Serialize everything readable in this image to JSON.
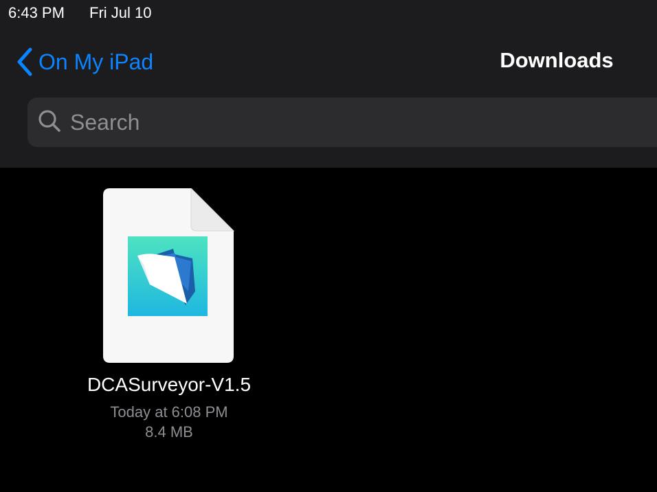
{
  "status_bar": {
    "time": "6:43 PM",
    "date": "Fri Jul 10"
  },
  "nav": {
    "back_label": "On My iPad",
    "title": "Downloads"
  },
  "search": {
    "placeholder": "Search",
    "value": ""
  },
  "files": [
    {
      "name": "DCASurveyor-V1.5",
      "modified": "Today at 6:08 PM",
      "size": "8.4 MB",
      "icon": "filemaker-folder-icon"
    }
  ],
  "colors": {
    "accent": "#0a84ff",
    "header_bg": "#1c1c1e",
    "search_bg": "#2c2c2e",
    "secondary_text": "#8e8e93",
    "background": "#000000"
  }
}
